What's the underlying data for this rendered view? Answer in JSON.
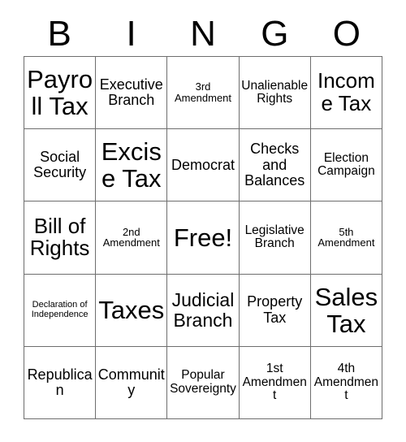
{
  "card": {
    "title": "BINGO Card",
    "header_letters": [
      "B",
      "I",
      "N",
      "G",
      "O"
    ],
    "grid": {
      "columns": 5,
      "rows": 5,
      "cells": [
        {
          "text": "Payroll Tax",
          "size": "s-xxl"
        },
        {
          "text": "Executive Branch",
          "size": "s-md"
        },
        {
          "text": "3rd Amendment",
          "size": "s-xs"
        },
        {
          "text": "Unalienable Rights",
          "size": "s-sm"
        },
        {
          "text": "Income Tax",
          "size": "s-xl"
        },
        {
          "text": "Social Security",
          "size": "s-md"
        },
        {
          "text": "Excise Tax",
          "size": "s-xxl"
        },
        {
          "text": "Democrat",
          "size": "s-md"
        },
        {
          "text": "Checks and Balances",
          "size": "s-md"
        },
        {
          "text": "Election Campaign",
          "size": "s-sm"
        },
        {
          "text": "Bill of Rights",
          "size": "s-xl"
        },
        {
          "text": "2nd Amendment",
          "size": "s-xs"
        },
        {
          "text": "Free!",
          "size": "s-xxl"
        },
        {
          "text": "Legislative Branch",
          "size": "s-sm"
        },
        {
          "text": "5th Amendment",
          "size": "s-xs"
        },
        {
          "text": "Declaration of Independence",
          "size": "s-xxs"
        },
        {
          "text": "Taxes",
          "size": "s-xxl"
        },
        {
          "text": "Judicial Branch",
          "size": "s-lg"
        },
        {
          "text": "Property Tax",
          "size": "s-md"
        },
        {
          "text": "Sales Tax",
          "size": "s-xxl"
        },
        {
          "text": "Republican",
          "size": "s-md"
        },
        {
          "text": "Community",
          "size": "s-md"
        },
        {
          "text": "Popular Sovereignty",
          "size": "s-sm"
        },
        {
          "text": "1st Amendment",
          "size": "s-sm"
        },
        {
          "text": "4th Amendment",
          "size": "s-sm"
        }
      ]
    },
    "colors": {
      "background": "#ffffff",
      "text": "#000000",
      "grid_line": "#6e6e6e"
    }
  }
}
